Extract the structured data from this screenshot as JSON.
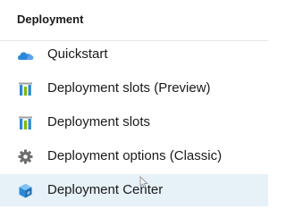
{
  "section": {
    "title": "Deployment"
  },
  "items": [
    {
      "label": "Quickstart",
      "icon": "quickstart-cloud-icon"
    },
    {
      "label": "Deployment slots (Preview)",
      "icon": "deployment-slots-icon"
    },
    {
      "label": "Deployment slots",
      "icon": "deployment-slots-icon"
    },
    {
      "label": "Deployment options (Classic)",
      "icon": "gear-icon"
    },
    {
      "label": "Deployment Center",
      "icon": "deployment-center-cube-icon",
      "selected": true
    }
  ],
  "colors": {
    "selected_background": "#e6f1f8",
    "accent_blue": "#2b88d8",
    "slot_green": "#7fba00",
    "gear_gray": "#6e6e6e"
  }
}
